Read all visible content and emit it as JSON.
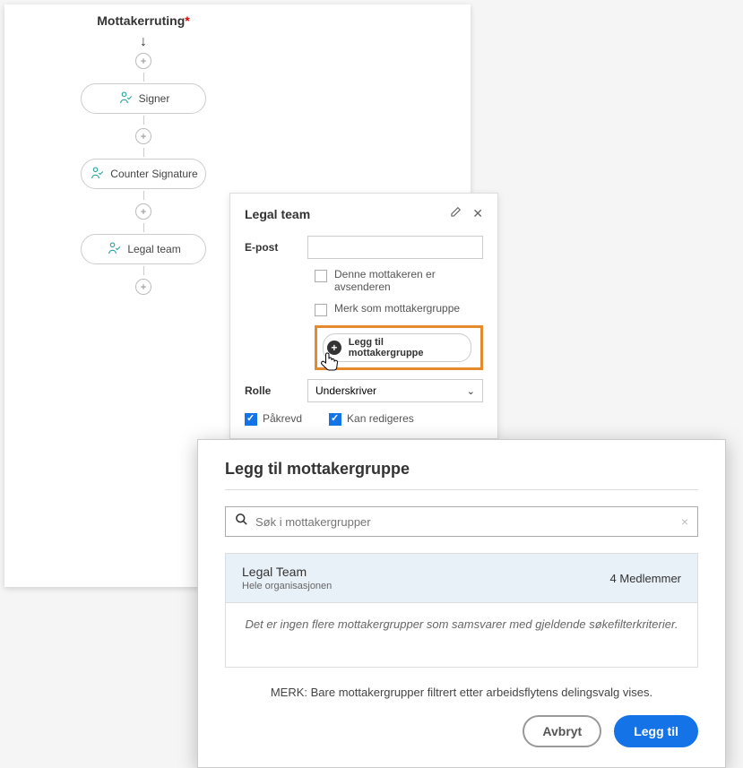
{
  "routing": {
    "title": "Mottakerruting",
    "items": [
      "Signer",
      "Counter Signature",
      "Legal team"
    ]
  },
  "detail": {
    "title": "Legal team",
    "email_label": "E-post",
    "email_value": "",
    "sender_checkbox": "Denne mottakeren er avsenderen",
    "group_checkbox": "Merk som mottakergruppe",
    "add_group_label": "Legg til mottakergruppe",
    "role_label": "Rolle",
    "role_value": "Underskriver",
    "required_label": "Påkrevd",
    "editable_label": "Kan redigeres"
  },
  "modal": {
    "title": "Legg til mottakergruppe",
    "search_placeholder": "Søk i mottakergrupper",
    "group": {
      "name": "Legal Team",
      "scope": "Hele organisasjonen",
      "members": "4 Medlemmer"
    },
    "empty_msg": "Det er ingen flere mottakergrupper som samsvarer med gjeldende søkefilterkriterier.",
    "note": "MERK: Bare mottakergrupper filtrert etter arbeidsflytens delingsvalg vises.",
    "cancel": "Avbryt",
    "add": "Legg til"
  }
}
